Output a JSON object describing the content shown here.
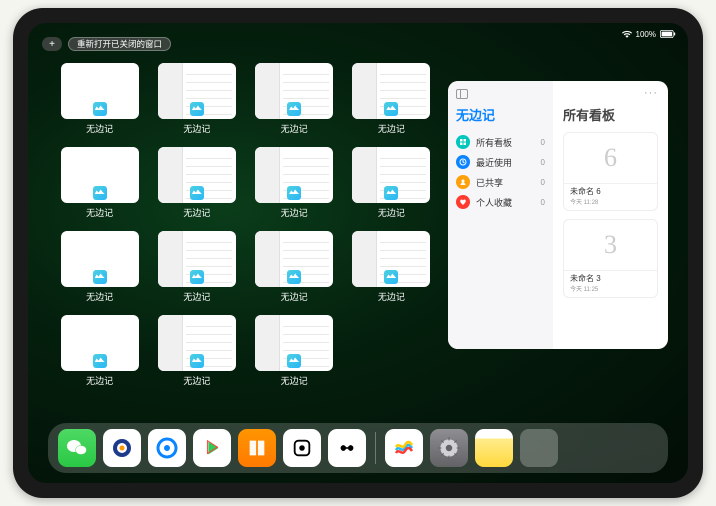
{
  "status": {
    "battery": "100%"
  },
  "top": {
    "plus_label": "+",
    "reopen_label": "重新打开已关闭的窗口"
  },
  "windows": [
    {
      "label": "无边记",
      "variant": "blank"
    },
    {
      "label": "无边记",
      "variant": "content"
    },
    {
      "label": "无边记",
      "variant": "content"
    },
    {
      "label": "无边记",
      "variant": "content"
    },
    {
      "label": "无边记",
      "variant": "blank"
    },
    {
      "label": "无边记",
      "variant": "content"
    },
    {
      "label": "无边记",
      "variant": "content"
    },
    {
      "label": "无边记",
      "variant": "content"
    },
    {
      "label": "无边记",
      "variant": "blank"
    },
    {
      "label": "无边记",
      "variant": "content"
    },
    {
      "label": "无边记",
      "variant": "content"
    },
    {
      "label": "无边记",
      "variant": "content"
    },
    {
      "label": "无边记",
      "variant": "blank"
    },
    {
      "label": "无边记",
      "variant": "content"
    },
    {
      "label": "无边记",
      "variant": "content"
    }
  ],
  "panel": {
    "title": "无边记",
    "more": "···",
    "nav": [
      {
        "label": "所有看板",
        "count": "0",
        "color": "#00c7be",
        "icon": "grid"
      },
      {
        "label": "最近使用",
        "count": "0",
        "color": "#0a84ff",
        "icon": "clock"
      },
      {
        "label": "已共享",
        "count": "0",
        "color": "#ff9f0a",
        "icon": "people"
      },
      {
        "label": "个人收藏",
        "count": "0",
        "color": "#ff3b30",
        "icon": "heart"
      }
    ],
    "right_title": "所有看板",
    "boards": [
      {
        "name": "未命名 6",
        "meta": "今天 11:28",
        "glyph": "6"
      },
      {
        "name": "未命名 3",
        "meta": "今天 11:25",
        "glyph": "3"
      }
    ]
  },
  "dock": {
    "apps": [
      "wechat",
      "tencent",
      "qbrowser",
      "play",
      "books",
      "dice",
      "tiktok"
    ],
    "apps2": [
      "freeform",
      "settings",
      "notes",
      "recents"
    ]
  }
}
